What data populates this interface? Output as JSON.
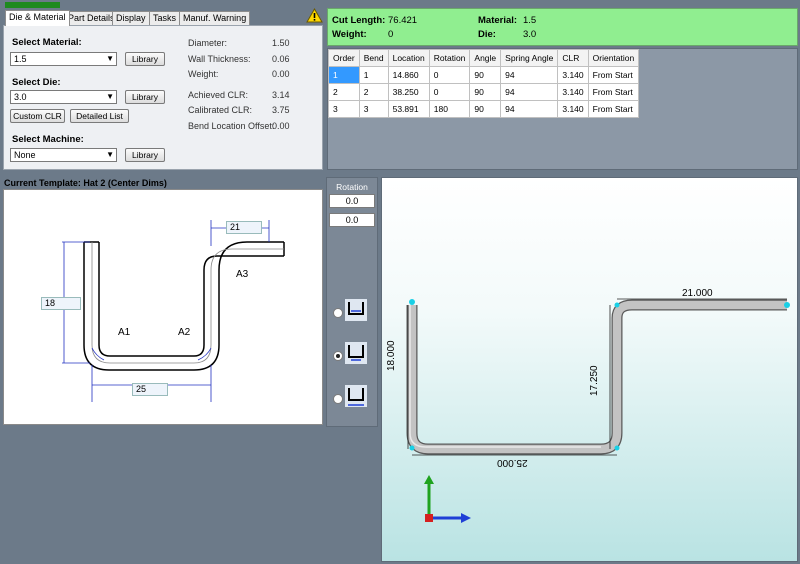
{
  "tabs": [
    {
      "label": "Die & Material",
      "active": true
    },
    {
      "label": "Part Details",
      "active": false
    },
    {
      "label": "Display",
      "active": false
    },
    {
      "label": "Tasks",
      "active": false
    },
    {
      "label": "Manuf. Warning",
      "active": false
    }
  ],
  "warning_icon": "warning-triangle-icon",
  "die_material": {
    "select_material_label": "Select Material:",
    "material_value": "1.5",
    "library_label": "Library",
    "select_die_label": "Select Die:",
    "die_value": "3.0",
    "custom_clr_label": "Custom CLR",
    "detailed_list_label": "Detailed List",
    "select_machine_label": "Select Machine:",
    "machine_value": "None",
    "props": [
      {
        "name": "Diameter:",
        "value": "1.50"
      },
      {
        "name": "Wall Thickness:",
        "value": "0.06"
      },
      {
        "name": "Weight:",
        "value": "0.00"
      },
      {
        "name": "Achieved CLR:",
        "value": "3.14"
      },
      {
        "name": "Calibrated CLR:",
        "value": "3.75"
      },
      {
        "name": "Bend Location Offset:",
        "value": "0.00"
      }
    ]
  },
  "summary": {
    "cut_length_label": "Cut Length:",
    "cut_length_value": "76.421",
    "weight_label": "Weight:",
    "weight_value": "0",
    "material_label": "Material:",
    "material_value": "1.5",
    "die_label": "Die:",
    "die_value": "3.0"
  },
  "bend_table": {
    "headers": [
      "Order",
      "Bend",
      "Location",
      "Rotation",
      "Angle",
      "Spring Angle",
      "CLR",
      "Orientation"
    ],
    "rows": [
      [
        "1",
        "1",
        "14.860",
        "0",
        "90",
        "94",
        "3.140",
        "From Start"
      ],
      [
        "2",
        "2",
        "38.250",
        "0",
        "90",
        "94",
        "3.140",
        "From Start"
      ],
      [
        "3",
        "3",
        "53.891",
        "180",
        "90",
        "94",
        "3.140",
        "From Start"
      ]
    ]
  },
  "template": {
    "title": "Current Template: Hat 2 (Center Dims)",
    "dim_top": "21",
    "dim_left": "18",
    "dim_bottom": "25",
    "label_a1": "A1",
    "label_a2": "A2",
    "label_a3": "A3"
  },
  "rotation": {
    "label": "Rotation",
    "value1": "0.0",
    "value2": "0.0",
    "options": [
      {
        "icon": "tube-orientation-open-up-icon",
        "selected": false
      },
      {
        "icon": "tube-orientation-center-icon",
        "selected": true
      },
      {
        "icon": "tube-orientation-bottom-icon",
        "selected": false
      }
    ]
  },
  "view3d": {
    "dim_top": "21.000",
    "dim_left": "18.000",
    "dim_right": "17.250",
    "dim_bottom": "25.000",
    "axis_icon": "xyz-axis-triad-icon",
    "axis_colors": {
      "x": "#1f3fd6",
      "y": "#1fa31f",
      "z": "#d61f1f"
    }
  }
}
